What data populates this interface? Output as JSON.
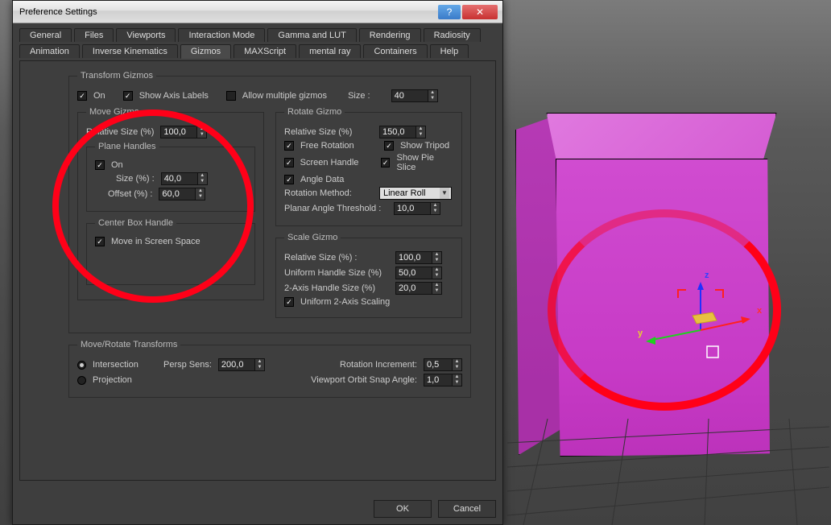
{
  "window": {
    "title": "Preference Settings"
  },
  "tabs_row1": [
    "General",
    "Files",
    "Viewports",
    "Interaction Mode",
    "Gamma and LUT",
    "Rendering",
    "Radiosity"
  ],
  "tabs_row2": [
    "Animation",
    "Inverse Kinematics",
    "Gizmos",
    "MAXScript",
    "mental ray",
    "Containers",
    "Help"
  ],
  "active_tab": "Gizmos",
  "transform_gizmos": {
    "legend": "Transform Gizmos",
    "on_label": "On",
    "show_axis_label": "Show Axis Labels",
    "allow_multiple_label": "Allow multiple gizmos",
    "size_label": "Size :",
    "size_value": "40"
  },
  "move_gizmo": {
    "legend": "Move Gizmo",
    "rel_size_label": "Relative Size (%)",
    "rel_size_value": "100,0",
    "plane_handles_legend": "Plane Handles",
    "plane_on_label": "On",
    "plane_size_label": "Size (%) :",
    "plane_size_value": "40,0",
    "plane_offset_label": "Offset (%) :",
    "plane_offset_value": "60,0",
    "center_box_legend": "Center Box Handle",
    "center_move_label": "Move in Screen Space"
  },
  "rotate_gizmo": {
    "legend": "Rotate Gizmo",
    "rel_size_label": "Relative Size (%)",
    "rel_size_value": "150,0",
    "free_rot_label": "Free Rotation",
    "show_tripod_label": "Show Tripod",
    "screen_handle_label": "Screen Handle",
    "show_pie_label": "Show Pie Slice",
    "angle_data_label": "Angle Data",
    "rot_method_label": "Rotation Method:",
    "rot_method_value": "Linear Roll",
    "planar_thresh_label": "Planar Angle Threshold :",
    "planar_thresh_value": "10,0"
  },
  "scale_gizmo": {
    "legend": "Scale Gizmo",
    "rel_size_label": "Relative Size (%) :",
    "rel_size_value": "100,0",
    "uniform_handle_label": "Uniform Handle Size (%)",
    "uniform_handle_value": "50,0",
    "twoaxis_label": "2-Axis Handle Size (%)",
    "twoaxis_value": "20,0",
    "uniform_scale_label": "Uniform 2-Axis Scaling"
  },
  "move_rotate": {
    "legend": "Move/Rotate Transforms",
    "intersection_label": "Intersection",
    "persp_sens_label": "Persp Sens:",
    "persp_sens_value": "200,0",
    "rot_incr_label": "Rotation Increment:",
    "rot_incr_value": "0,5",
    "projection_label": "Projection",
    "orbit_snap_label": "Viewport Orbit Snap Angle:",
    "orbit_snap_value": "1,0"
  },
  "buttons": {
    "ok": "OK",
    "cancel": "Cancel"
  },
  "gizmo_axes": {
    "x": "x",
    "y": "y",
    "z": "z"
  }
}
